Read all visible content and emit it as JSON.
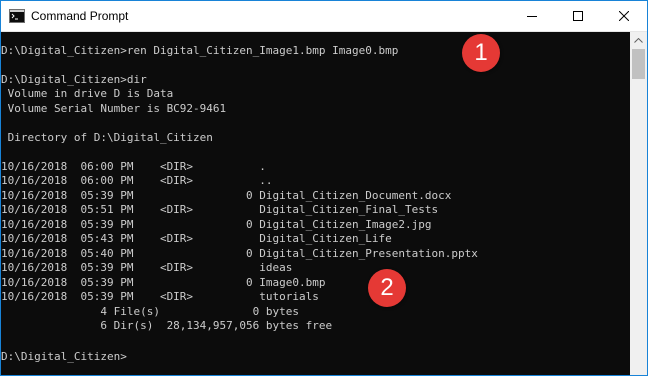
{
  "window": {
    "title": "Command Prompt",
    "icon": "cmd-terminal-icon",
    "controls": {
      "minimize": "minimize-icon",
      "maximize": "maximize-icon",
      "close": "close-icon"
    }
  },
  "console": {
    "lines": [
      "D:\\Digital_Citizen>ren Digital_Citizen_Image1.bmp Image0.bmp",
      "",
      "D:\\Digital_Citizen>dir",
      " Volume in drive D is Data",
      " Volume Serial Number is BC92-9461",
      "",
      " Directory of D:\\Digital_Citizen",
      "",
      "10/16/2018  06:00 PM    <DIR>          .",
      "10/16/2018  06:00 PM    <DIR>          ..",
      "10/16/2018  05:39 PM                 0 Digital_Citizen_Document.docx",
      "10/16/2018  05:51 PM    <DIR>          Digital_Citizen_Final_Tests",
      "10/16/2018  05:39 PM                 0 Digital_Citizen_Image2.jpg",
      "10/16/2018  05:43 PM    <DIR>          Digital_Citizen_Life",
      "10/16/2018  05:40 PM                 0 Digital_Citizen_Presentation.pptx",
      "10/16/2018  05:39 PM    <DIR>          ideas",
      "10/16/2018  05:39 PM                 0 Image0.bmp",
      "10/16/2018  05:39 PM    <DIR>          tutorials",
      "               4 File(s)              0 bytes",
      "               6 Dir(s)  28,134,957,056 bytes free",
      "",
      "D:\\Digital_Citizen>"
    ]
  },
  "annotations": {
    "badge_1": "1",
    "badge_2": "2"
  },
  "colors": {
    "console_background": "#0c0c0c",
    "console_text": "#cccccc",
    "badge": "#e53935",
    "window_border": "#1883d7"
  }
}
